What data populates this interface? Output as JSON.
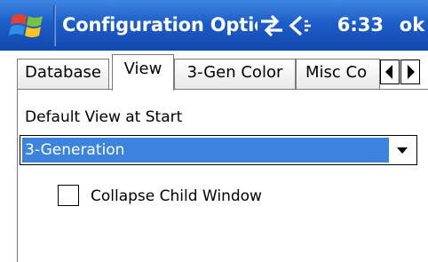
{
  "title_bar": {
    "title": "Configuration Optior",
    "clock": "6:33",
    "ok_label": "ok",
    "icons": [
      "windows-flag-icon",
      "connectivity-icon",
      "volume-icon"
    ],
    "background": "#1d5dc8"
  },
  "tabs": {
    "items": [
      {
        "label": "Database",
        "active": false
      },
      {
        "label": "View",
        "active": true
      },
      {
        "label": "3-Gen Color",
        "active": false
      },
      {
        "label": "Misc Co",
        "active": false
      }
    ],
    "scroll_icons": [
      "arrow-left-icon",
      "arrow-right-icon"
    ]
  },
  "view_panel": {
    "default_view_label": "Default View at Start",
    "default_view_value": "3-Generation",
    "collapse_label": "Collapse Child Window",
    "collapse_checked": false,
    "selection_color": "#3b83dd"
  }
}
